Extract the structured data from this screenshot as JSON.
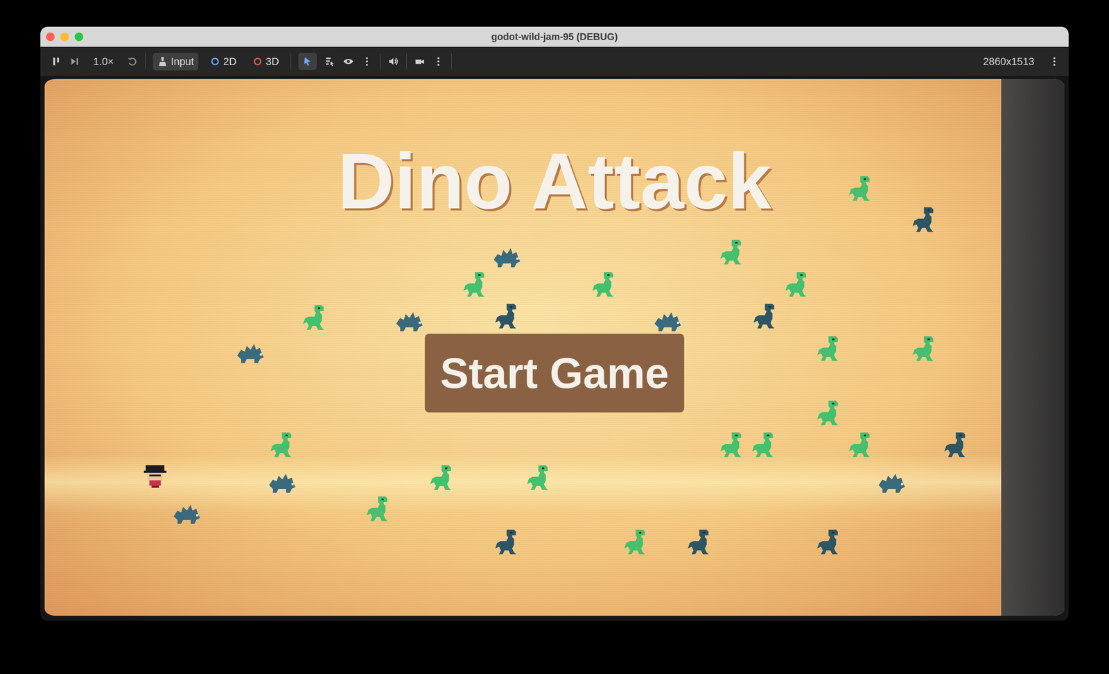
{
  "window": {
    "title": "godot-wild-jam-95 (DEBUG)"
  },
  "toolbar": {
    "speed": "1.0×",
    "modes": [
      {
        "label": "Input",
        "kind": "joypad",
        "selected": true,
        "color": "#d0d0d0"
      },
      {
        "label": "2D",
        "kind": "circle",
        "selected": false,
        "color": "#5fa8e8"
      },
      {
        "label": "3D",
        "kind": "circle",
        "selected": false,
        "color": "#e05555"
      }
    ],
    "select_tool_active": true,
    "resolution": "2860x1513"
  },
  "game": {
    "title": "Dino Attack",
    "button": "Start Game",
    "enemies": [
      {
        "kind": "green"
      },
      {
        "kind": "green"
      },
      {
        "kind": "green"
      },
      {
        "kind": "green"
      },
      {
        "kind": "green"
      },
      {
        "kind": "green"
      },
      {
        "kind": "green"
      },
      {
        "kind": "green"
      },
      {
        "kind": "green"
      },
      {
        "kind": "green"
      },
      {
        "kind": "green"
      },
      {
        "kind": "green"
      },
      {
        "kind": "green"
      },
      {
        "kind": "green"
      },
      {
        "kind": "green"
      },
      {
        "kind": "green"
      },
      {
        "kind": "green"
      },
      {
        "kind": "raptor"
      },
      {
        "kind": "raptor"
      },
      {
        "kind": "raptor"
      },
      {
        "kind": "raptor"
      },
      {
        "kind": "raptor"
      },
      {
        "kind": "raptor"
      },
      {
        "kind": "raptor"
      },
      {
        "kind": "spiky"
      },
      {
        "kind": "spiky"
      },
      {
        "kind": "spiky"
      },
      {
        "kind": "spiky"
      },
      {
        "kind": "spiky"
      },
      {
        "kind": "spiky"
      },
      {
        "kind": "spiky"
      }
    ]
  }
}
